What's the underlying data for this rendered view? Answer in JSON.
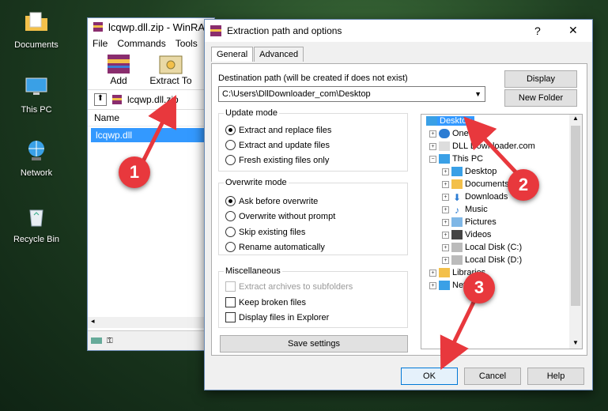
{
  "desktop": {
    "icons": [
      {
        "label": "Documents"
      },
      {
        "label": "This PC"
      },
      {
        "label": "Network"
      },
      {
        "label": "Recycle Bin"
      }
    ]
  },
  "winrar": {
    "title": "lcqwp.dll.zip - WinRA",
    "menu": [
      "File",
      "Commands",
      "Tools"
    ],
    "toolbar": {
      "add": "Add",
      "extract_to": "Extract To"
    },
    "path": "lcqwp.dll.zip",
    "column_name": "Name",
    "file": "lcqwp.dll"
  },
  "dialog": {
    "title": "Extraction path and options",
    "help": "?",
    "close": "✕",
    "tabs": [
      "General",
      "Advanced"
    ],
    "dest_label": "Destination path (will be created if does not exist)",
    "dest_value": "C:\\Users\\DllDownloader_com\\Desktop",
    "display_btn": "Display",
    "new_folder_btn": "New Folder",
    "update_mode": {
      "title": "Update mode",
      "options": [
        "Extract and replace files",
        "Extract and update files",
        "Fresh existing files only"
      ],
      "selected": 0
    },
    "overwrite_mode": {
      "title": "Overwrite mode",
      "options": [
        "Ask before overwrite",
        "Overwrite without prompt",
        "Skip existing files",
        "Rename automatically"
      ],
      "selected": 0
    },
    "misc": {
      "title": "Miscellaneous",
      "options": [
        "Extract archives to subfolders",
        "Keep broken files",
        "Display files in Explorer"
      ]
    },
    "save_settings": "Save settings",
    "tree": [
      "Desktop",
      "OneDrive",
      "DLL Downloader.com",
      "This PC",
      "Desktop",
      "Documents",
      "Downloads",
      "Music",
      "Pictures",
      "Videos",
      "Local Disk (C:)",
      "Local Disk (D:)",
      "Libraries",
      "Network"
    ],
    "ok": "OK",
    "cancel": "Cancel",
    "help_btn": "Help"
  },
  "annotations": [
    "1",
    "2",
    "3"
  ],
  "colors": {
    "arrow": "#e8383d",
    "selection": "#3399ff"
  }
}
